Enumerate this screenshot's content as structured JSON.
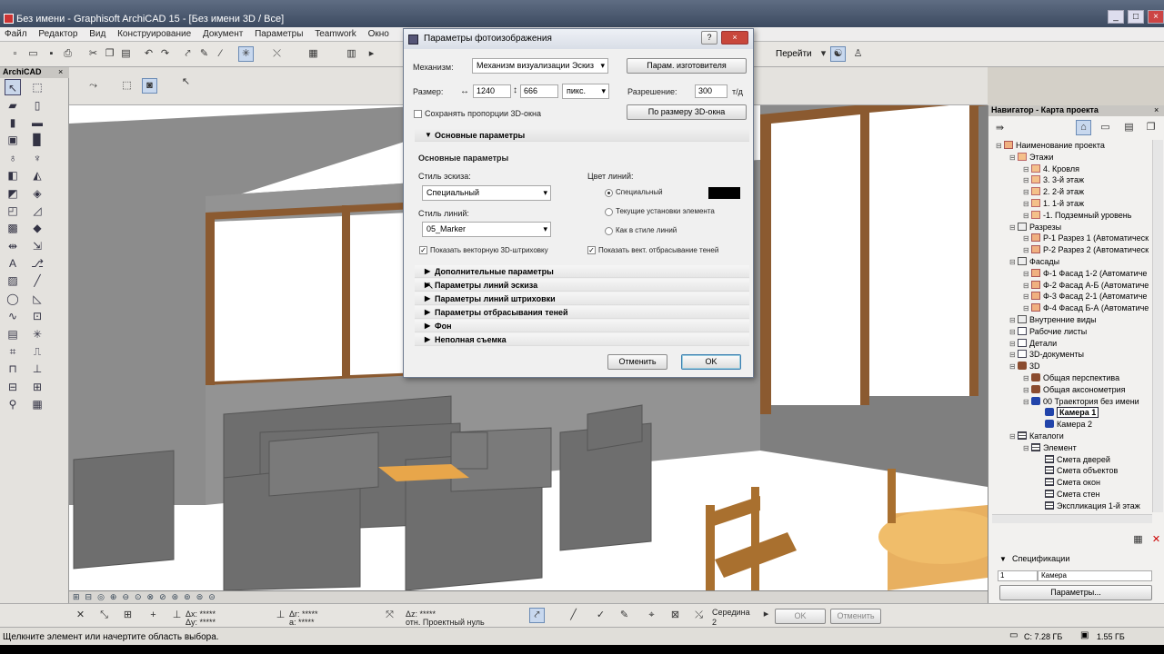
{
  "window": {
    "title": "Без имени - Graphisoft ArchiCAD 15 - [Без имени 3D / Все]"
  },
  "menubar": [
    "Файл",
    "Редактор",
    "Вид",
    "Конструирование",
    "Документ",
    "Параметры",
    "Teamwork",
    "Окно"
  ],
  "toolbar": {
    "goto_label": "Перейти"
  },
  "toolbox": {
    "title": "ArchiCAD"
  },
  "dialog": {
    "title": "Параметры фотоизображения",
    "mechanism_label": "Механизм:",
    "mechanism_value": "Механизм визуализации Эскиз",
    "vendor_button": "Парам. изготовителя",
    "size_label": "Размер:",
    "width": "1240",
    "height": "666",
    "unit": "пикс.",
    "resolution_label": "Разрешение:",
    "resolution": "300",
    "resolution_unit": "т/д",
    "keep_ratio": "Сохранять пропорции 3D-окна",
    "fit_button": "По размеру 3D-окна",
    "basic_section": "Основные параметры",
    "basic_heading": "Основные параметры",
    "sketch_style_label": "Стиль эскиза:",
    "sketch_style": "Специальный",
    "line_style_label": "Стиль линий:",
    "line_style": "05_Marker",
    "line_color_label": "Цвет линий:",
    "radio_special": "Специальный",
    "radio_current": "Текущие установки элемента",
    "radio_linestyle": "Как в стиле линий",
    "line_color": "#000000",
    "show_vector_hatch": "Показать векторную 3D-штриховку",
    "show_vector_shadow": "Показать вект. отбрасывание теней",
    "collapsed_sections": [
      "Дополнительные параметры",
      "Параметры линий эскиза",
      "Параметры линий штриховки",
      "Параметры отбрасывания теней",
      "Фон",
      "Неполная съемка"
    ],
    "cancel": "Отменить",
    "ok": "OK"
  },
  "navigator": {
    "title": "Навигатор - Карта проекта",
    "tree": [
      {
        "label": "Наименование проекта",
        "level": 0,
        "icon": "house-icon"
      },
      {
        "label": "Этажи",
        "level": 1,
        "icon": "floors-icon"
      },
      {
        "label": "4. Кровля",
        "level": 2,
        "icon": "floor-icon"
      },
      {
        "label": "3. 3-й этаж",
        "level": 2,
        "icon": "floor-icon"
      },
      {
        "label": "2. 2-й этаж",
        "level": 2,
        "icon": "floor-icon"
      },
      {
        "label": "1. 1-й этаж",
        "level": 2,
        "icon": "floor-icon"
      },
      {
        "label": "-1. Подземный уровень",
        "level": 2,
        "icon": "floor-icon"
      },
      {
        "label": "Разрезы",
        "level": 1,
        "icon": "section-icon"
      },
      {
        "label": "Р-1 Разрез 1 (Автоматическ",
        "level": 2,
        "icon": "house-icon"
      },
      {
        "label": "Р-2 Разрез 2 (Автоматическ",
        "level": 2,
        "icon": "house-icon"
      },
      {
        "label": "Фасады",
        "level": 1,
        "icon": "section-icon"
      },
      {
        "label": "Ф-1 Фасад 1-2 (Автоматиче",
        "level": 2,
        "icon": "house-icon"
      },
      {
        "label": "Ф-2 Фасад А-Б (Автоматиче",
        "level": 2,
        "icon": "house-icon"
      },
      {
        "label": "Ф-3 Фасад 2-1 (Автоматиче",
        "level": 2,
        "icon": "house-icon"
      },
      {
        "label": "Ф-4 Фасад Б-А (Автоматиче",
        "level": 2,
        "icon": "house-icon"
      },
      {
        "label": "Внутренние виды",
        "level": 1,
        "icon": "section-icon"
      },
      {
        "label": "Рабочие листы",
        "level": 1,
        "icon": "list-icon"
      },
      {
        "label": "Детали",
        "level": 1,
        "icon": "list-icon"
      },
      {
        "label": "3D-документы",
        "level": 1,
        "icon": "list-icon"
      },
      {
        "label": "3D",
        "level": 1,
        "icon": "3d-icon"
      },
      {
        "label": "Общая перспектива",
        "level": 2,
        "icon": "3d-icon"
      },
      {
        "label": "Общая аксонометрия",
        "level": 2,
        "icon": "3d-icon"
      },
      {
        "label": "00 Траектория без имени",
        "level": 2,
        "icon": "camera-icon"
      },
      {
        "label": "Камера 1",
        "level": 3,
        "icon": "camera-icon",
        "selected": true
      },
      {
        "label": "Камера 2",
        "level": 3,
        "icon": "camera-icon"
      },
      {
        "label": "Каталоги",
        "level": 1,
        "icon": "grid-icon"
      },
      {
        "label": "Элемент",
        "level": 2,
        "icon": "grid-icon"
      },
      {
        "label": "Смета дверей",
        "level": 3,
        "icon": "grid-icon"
      },
      {
        "label": "Смета объектов",
        "level": 3,
        "icon": "grid-icon"
      },
      {
        "label": "Смета окон",
        "level": 3,
        "icon": "grid-icon"
      },
      {
        "label": "Смета стен",
        "level": 3,
        "icon": "grid-icon"
      },
      {
        "label": "Экспликация 1-й этаж",
        "level": 3,
        "icon": "grid-icon"
      }
    ],
    "specs_label": "Спецификации",
    "spec_id": "1",
    "spec_name": "Камера",
    "params_button": "Параметры..."
  },
  "coords": {
    "dx": "Δx: *****",
    "dy": "Δy: *****",
    "dr": "Δr: *****",
    "da": "a: *****",
    "dz": "Δz: *****",
    "ref": "отн. Проектный нуль",
    "midpoint": "Середина",
    "midpoint_num": "2",
    "ok": "OK",
    "cancel": "Отменить"
  },
  "status": {
    "message": "Щелкните элемент или начертите область выбора.",
    "disk": "C: 7.28 ГБ",
    "ram": "1.55 ГБ"
  }
}
